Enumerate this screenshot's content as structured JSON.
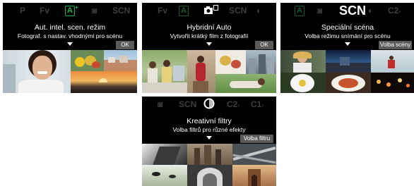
{
  "screens": {
    "auto": {
      "modes": {
        "p": "P",
        "fv": "Fv",
        "cam": "◙",
        "scn": "SCN",
        "selected": "A",
        "selected_plus": "+"
      },
      "title": "Aut. intel. scen. režim",
      "description": "Fotograf. s nastav. vhodnými pro scénu",
      "button": "OK"
    },
    "hybrid": {
      "modes": {
        "fv": "Fv",
        "a": "A",
        "scn": "SCN",
        "filt": "◐"
      },
      "title": "Hybridní Auto",
      "description": "Vytvořit krátký film z fotografií",
      "button": "OK"
    },
    "scene": {
      "modes": {
        "a": "A",
        "cam": "◙",
        "selected": "SCN",
        "filt": "◐",
        "c2": "C2",
        "c2_marker": "›"
      },
      "title": "Speciální scéna",
      "description": "Volba režimu snímání pro scénu",
      "button": "Volba scény"
    },
    "filter": {
      "modes": {
        "cam": "◙",
        "scn": "SCN",
        "c2": "C2",
        "c2_marker": "›",
        "c1": "C1",
        "c1_marker": "›"
      },
      "title": "Kreativní filtry",
      "description": "Volba filtrů pro různé efekty",
      "button": "Volba filtru"
    }
  }
}
